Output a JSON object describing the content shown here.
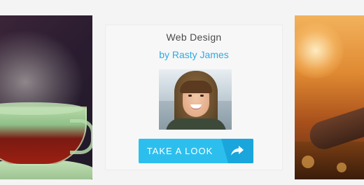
{
  "card": {
    "title": "Web Design",
    "author": "by Rasty James",
    "cta_label": "TAKE A LOOK",
    "cta_icon": "share-arrow-icon"
  },
  "colors": {
    "background": "#f4f4f4",
    "card_background": "#f7f7f7",
    "title_text": "#4a4a4a",
    "author_text": "#2cabe3",
    "cta_primary": "#2cbfee",
    "cta_secondary": "#1aa6dc",
    "cta_text": "#ffffff"
  },
  "images": {
    "left": "tea-cup-steam-photo",
    "avatar": "woman-fur-hood-portrait",
    "right": "sunset-field-legs-photo"
  }
}
